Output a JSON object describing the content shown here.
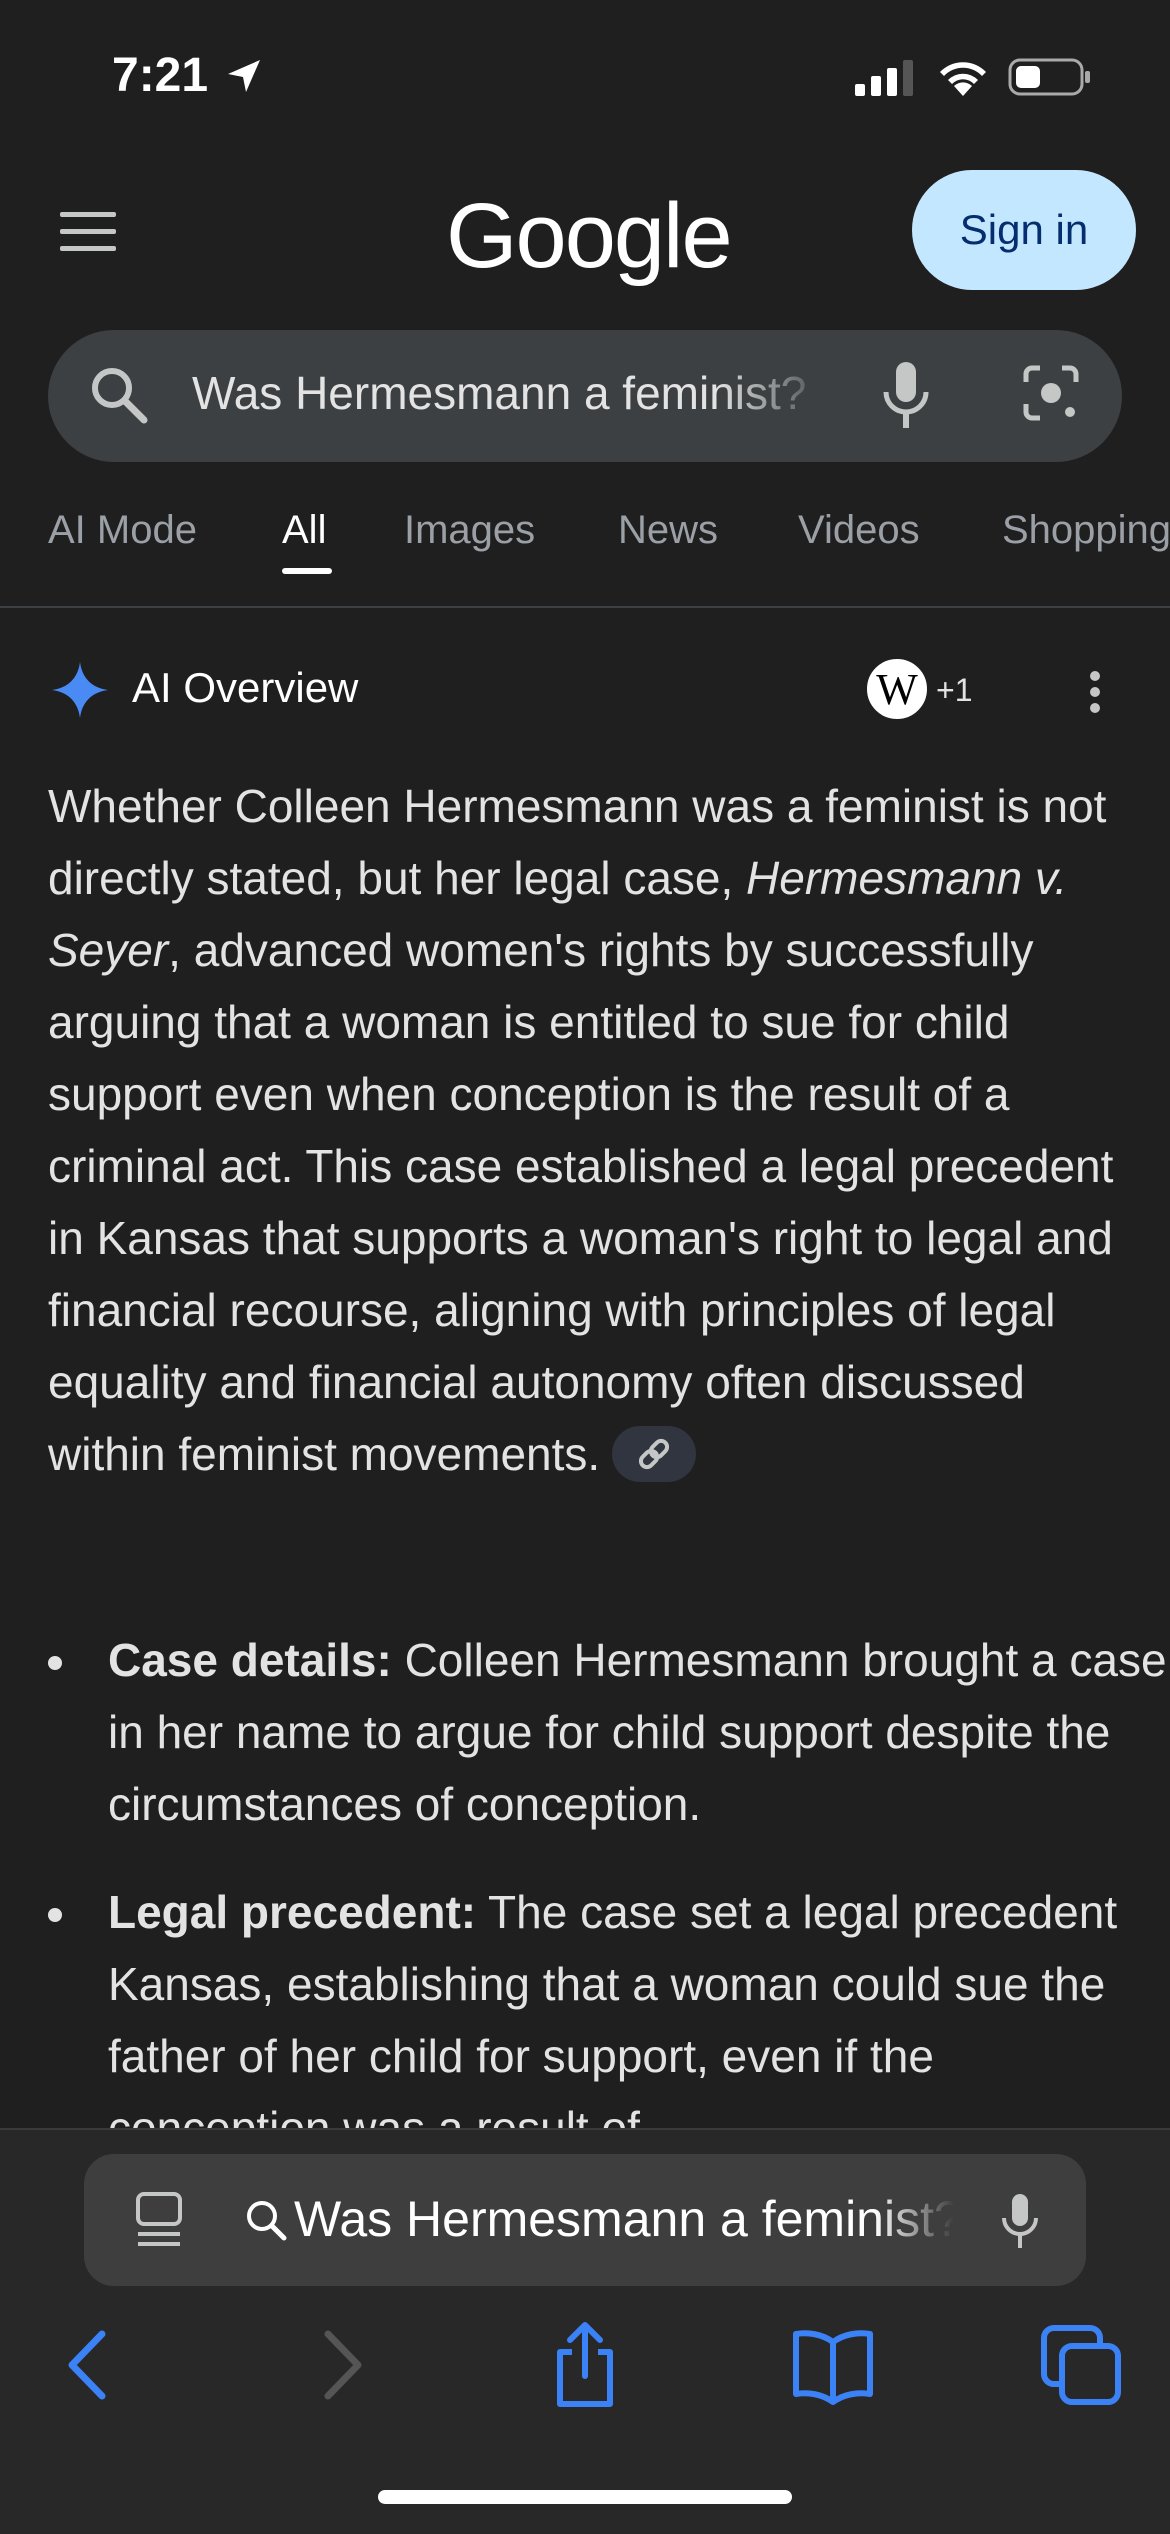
{
  "status_bar": {
    "time": "7:21"
  },
  "header": {
    "logo": "Google",
    "sign_in_label": "Sign in",
    "search_query": "Was Hermesmann a feminist?"
  },
  "tabs": [
    {
      "label": "AI Mode"
    },
    {
      "label": "All",
      "selected": true
    },
    {
      "label": "Images"
    },
    {
      "label": "News"
    },
    {
      "label": "Videos"
    },
    {
      "label": "Shopping"
    }
  ],
  "ai_overview": {
    "title": "AI Overview",
    "source_logo_letter": "W",
    "source_more": "+1",
    "paragraph": {
      "text_1": "Whether Colleen Hermesmann was a feminist is not directly stated, but her legal case, ",
      "case_name": "Hermesmann v. Seyer",
      "text_2": ", advanced women's rights by successfully arguing that a woman is entitled to sue for child support even when conception is the result of a criminal act. This case established a legal precedent in Kansas that supports a woman's right to legal and financial recourse, aligning with principles of legal equality and financial autonomy often discussed within feminist movements."
    },
    "bullets": [
      {
        "label": "Case details:",
        "text": " Colleen Hermesmann brought a case in her name to argue for child support despite the circumstances of conception."
      },
      {
        "label": "Legal precedent:",
        "text": " The case set a legal precedent in Kansas, establishing that a woman could sue the father of her child for support, even if the conception was a result of"
      }
    ]
  },
  "browser": {
    "address_text": "Was Hermesmann a feminist?"
  },
  "colors": {
    "background": "#1f1f1f",
    "sign_in_bg": "#c2e7ff",
    "accent_blue": "#3b82f6",
    "search_bg": "#3c4043"
  }
}
